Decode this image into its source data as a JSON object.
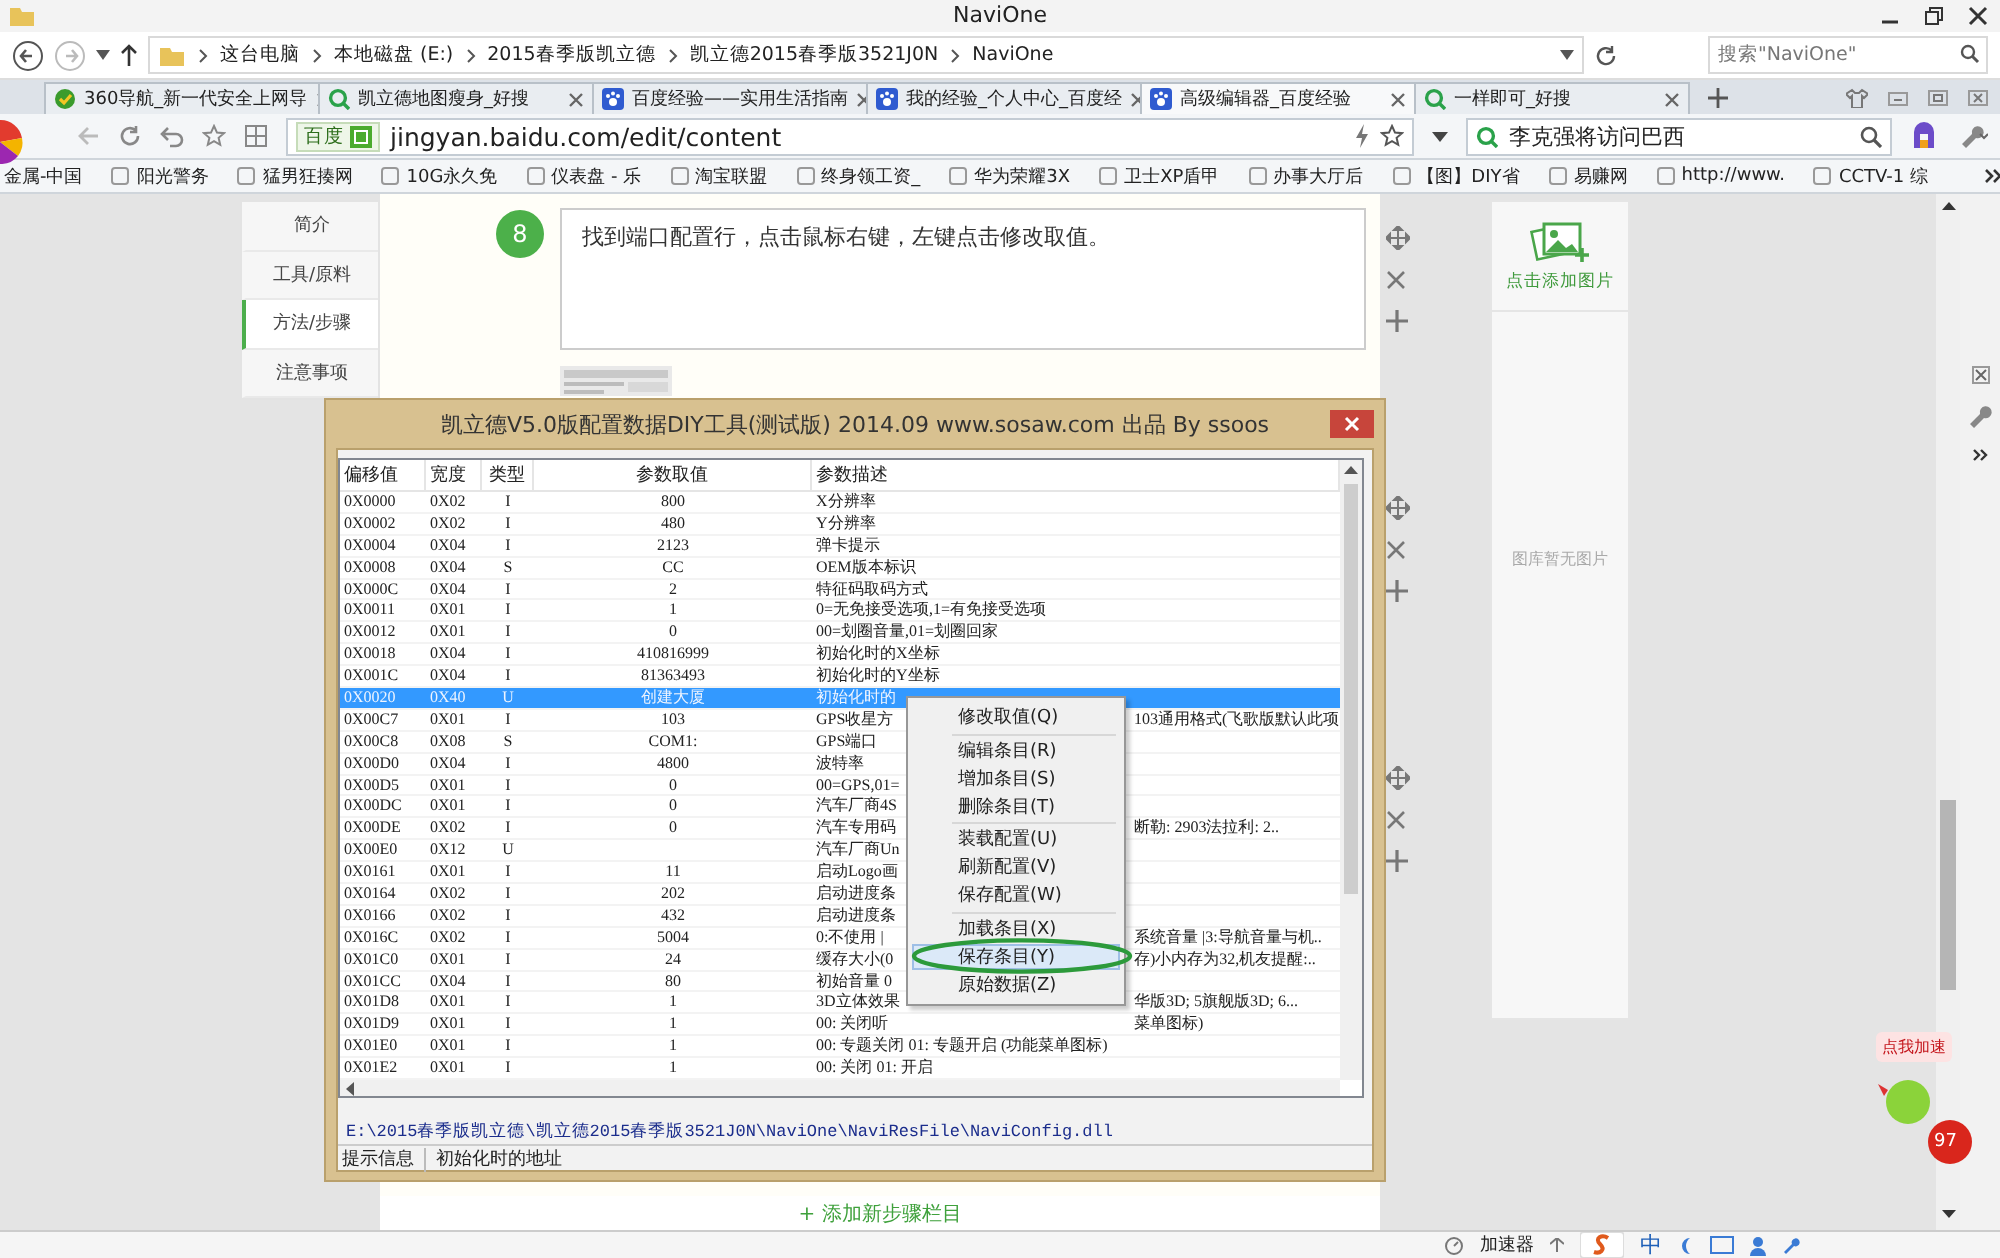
{
  "window": {
    "title": "NaviOne"
  },
  "explorer": {
    "path": [
      "这台电脑",
      "本地磁盘 (E:)",
      "2015春季版凯立德",
      "凯立德2015春季版3521J0N",
      "NaviOne"
    ],
    "search": {
      "placeholder": "搜索\"NaviOne\""
    }
  },
  "browser": {
    "tabs": [
      {
        "label": "360导航_新一代安全上网导",
        "kind": "shield",
        "selected": false
      },
      {
        "label": "凯立德地图瘦身_好搜",
        "kind": "search",
        "selected": false
      },
      {
        "label": "百度经验——实用生活指南",
        "kind": "paw",
        "selected": false
      },
      {
        "label": "我的经验_个人中心_百度经",
        "kind": "paw",
        "selected": false
      },
      {
        "label": "高级编辑器_百度经验",
        "kind": "paw",
        "selected": true
      },
      {
        "label": "一样即可_好搜",
        "kind": "search",
        "selected": false
      }
    ],
    "address": {
      "site_label": "百度",
      "url": "jingyan.baidu.com/edit/content"
    },
    "search": {
      "value": "李克强将访问巴西"
    },
    "bookmarks": [
      "金属-中国",
      "阳光警务",
      "猛男狂揍网",
      "10G永久免",
      "仪表盘 - 乐",
      "淘宝联盟",
      "终身领工资_",
      "华为荣耀3X",
      "卫士XP盾甲",
      "办事大厅后",
      "【图】DIY省",
      "易赚网",
      "http://www.",
      "CCTV-1 综"
    ]
  },
  "page": {
    "nav": [
      {
        "label": "简介",
        "selected": false
      },
      {
        "label": "工具/原料",
        "selected": false
      },
      {
        "label": "方法/步骤",
        "selected": true
      },
      {
        "label": "注意事项",
        "selected": false
      }
    ],
    "step": {
      "number": "8",
      "text": "找到端口配置行，点击鼠标右键，左键点击修改取值。"
    },
    "add_step": "+ 添加新步骤栏目",
    "gallery": {
      "add_label": "点击添加图片",
      "empty_label": "图库暂无图片"
    }
  },
  "dialog": {
    "title": "凯立德V5.0版配置数据DIY工具(测试版) 2014.09  www.sosaw.com 出品 By ssoos",
    "columns": [
      "偏移值",
      "宽度",
      "类型",
      "参数取值",
      "参数描述"
    ],
    "rows": [
      {
        "offset": "0X0000",
        "width": "0X02",
        "type": "I",
        "value": "800",
        "description": "X分辨率",
        "selected": false
      },
      {
        "offset": "0X0002",
        "width": "0X02",
        "type": "I",
        "value": "480",
        "description": "Y分辨率",
        "selected": false
      },
      {
        "offset": "0X0004",
        "width": "0X04",
        "type": "I",
        "value": "2123",
        "description": "弹卡提示",
        "selected": false
      },
      {
        "offset": "0X0008",
        "width": "0X04",
        "type": "S",
        "value": "CC",
        "description": "OEM版本标识",
        "selected": false
      },
      {
        "offset": "0X000C",
        "width": "0X04",
        "type": "I",
        "value": "2",
        "description": "特征码取码方式",
        "selected": false
      },
      {
        "offset": "0X0011",
        "width": "0X01",
        "type": "I",
        "value": "1",
        "description": "0=无免接受选项,1=有免接受选项",
        "selected": false
      },
      {
        "offset": "0X0012",
        "width": "0X01",
        "type": "I",
        "value": "0",
        "description": "00=划圈音量,01=划圈回家",
        "selected": false
      },
      {
        "offset": "0X0018",
        "width": "0X04",
        "type": "I",
        "value": "410816999",
        "description": "初始化时的X坐标",
        "selected": false
      },
      {
        "offset": "0X001C",
        "width": "0X04",
        "type": "I",
        "value": "81363493",
        "description": "初始化时的Y坐标",
        "selected": false
      },
      {
        "offset": "0X0020",
        "width": "0X40",
        "type": "U",
        "value": "创建大厦",
        "description": "初始化时的",
        "selected": true
      },
      {
        "offset": "0X00C7",
        "width": "0X01",
        "type": "I",
        "value": "103",
        "description": "GPS收星方",
        "description_right": "103通用格式(飞歌版默认此项",
        "selected": false
      },
      {
        "offset": "0X00C8",
        "width": "0X08",
        "type": "S",
        "value": "COM1:",
        "description": "GPS端口",
        "selected": false
      },
      {
        "offset": "0X00D0",
        "width": "0X04",
        "type": "I",
        "value": "4800",
        "description": "波特率",
        "selected": false
      },
      {
        "offset": "0X00D5",
        "width": "0X01",
        "type": "I",
        "value": "0",
        "description": "00=GPS,01=",
        "selected": false
      },
      {
        "offset": "0X00DC",
        "width": "0X01",
        "type": "I",
        "value": "0",
        "description": "汽车厂商4S",
        "selected": false
      },
      {
        "offset": "0X00DE",
        "width": "0X02",
        "type": "I",
        "value": "0",
        "description": "汽车专用码",
        "description_right": "断勒:   2903法拉利:    2..",
        "selected": false
      },
      {
        "offset": "0X00E0",
        "width": "0X12",
        "type": "U",
        "description": "汽车厂商Un",
        "selected": false
      },
      {
        "offset": "0X0161",
        "width": "0X01",
        "type": "I",
        "value": "11",
        "description": "启动Logo画",
        "selected": false
      },
      {
        "offset": "0X0164",
        "width": "0X02",
        "type": "I",
        "value": "202",
        "description": "启动进度条",
        "selected": false
      },
      {
        "offset": "0X0166",
        "width": "0X02",
        "type": "I",
        "value": "432",
        "description": "启动进度条",
        "selected": false
      },
      {
        "offset": "0X016C",
        "width": "0X02",
        "type": "I",
        "value": "5004",
        "description": "0:不使用 |",
        "description_right": "系统音量 |3:导航音量与机..",
        "selected": false
      },
      {
        "offset": "0X01C0",
        "width": "0X01",
        "type": "I",
        "value": "24",
        "description": "缓存大小(0",
        "description_right": "存)小内存为32,机友提醒:..",
        "selected": false
      },
      {
        "offset": "0X01CC",
        "width": "0X04",
        "type": "I",
        "value": "80",
        "description": "初始音量 0",
        "selected": false
      },
      {
        "offset": "0X01D8",
        "width": "0X01",
        "type": "I",
        "value": "1",
        "description": "3D立体效果",
        "description_right": "华版3D; 5旗舰版3D; 6...",
        "selected": false
      },
      {
        "offset": "0X01D9",
        "width": "0X01",
        "type": "I",
        "value": "1",
        "description": "00: 关闭听",
        "description_right": "菜单图标)",
        "selected": false
      },
      {
        "offset": "0X01E0",
        "width": "0X01",
        "type": "I",
        "value": "1",
        "description": "00: 专题关闭   01: 专题开启   (功能菜单图标)",
        "selected": false
      },
      {
        "offset": "0X01E2",
        "width": "0X01",
        "type": "I",
        "value": "1",
        "description": "00: 关闭   01: 开启",
        "selected": false
      }
    ],
    "path": "E:\\2015春季版凯立德\\凯立德2015春季版3521J0N\\NaviOne\\NaviResFile\\NaviConfig.dll",
    "status": {
      "label": "提示信息",
      "value": "初始化时的地址"
    },
    "context_menu": [
      {
        "kind": "item",
        "label": "修改取值(Q)",
        "selected": false
      },
      {
        "kind": "separator"
      },
      {
        "kind": "item",
        "label": "编辑条目(R)",
        "selected": false
      },
      {
        "kind": "item",
        "label": "增加条目(S)",
        "selected": false
      },
      {
        "kind": "item",
        "label": "删除条目(T)",
        "selected": false
      },
      {
        "kind": "separator"
      },
      {
        "kind": "item",
        "label": "装载配置(U)",
        "selected": false
      },
      {
        "kind": "item",
        "label": "刷新配置(V)",
        "selected": false
      },
      {
        "kind": "item",
        "label": "保存配置(W)",
        "selected": false
      },
      {
        "kind": "separator"
      },
      {
        "kind": "item",
        "label": "加载条目(X)",
        "selected": false
      },
      {
        "kind": "item",
        "label": "保存条目(Y)",
        "selected": true
      },
      {
        "kind": "item",
        "label": "原始数据(Z)",
        "selected": false
      }
    ]
  },
  "speed_widget": {
    "label": "点我加速",
    "badge": "97"
  },
  "taskbar": {
    "items": [
      "加速器",
      "中"
    ]
  }
}
